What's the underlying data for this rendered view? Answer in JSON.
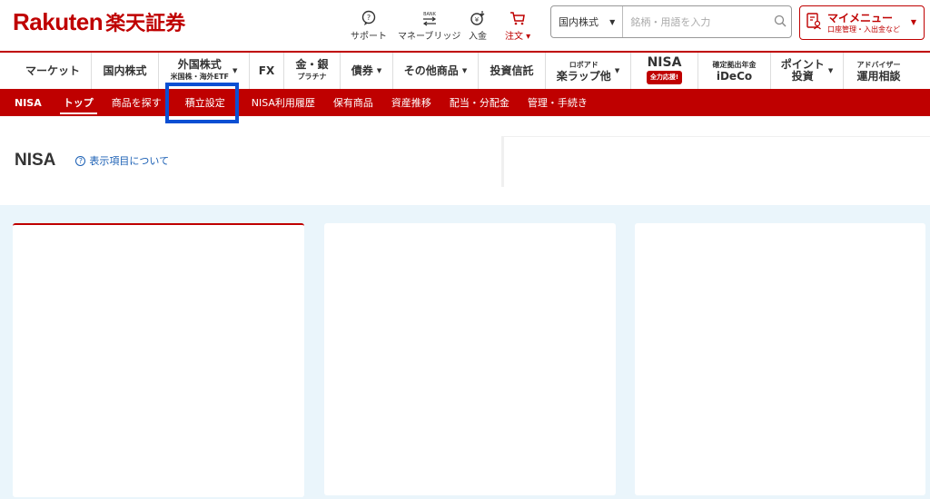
{
  "header": {
    "logo_en": "Rakuten",
    "logo_jp": "楽天証券",
    "utils": [
      {
        "label": "サポート",
        "icon": "support-icon"
      },
      {
        "label": "マネーブリッジ",
        "icon": "bank-icon"
      },
      {
        "label": "入金",
        "icon": "deposit-icon"
      },
      {
        "label": "注文 ▾",
        "icon": "cart-icon"
      }
    ],
    "search": {
      "category": "国内株式",
      "placeholder": "銘柄・用語を入力"
    },
    "my_menu": {
      "title": "マイメニュー",
      "subtitle": "口座管理・入出金など"
    }
  },
  "global_nav": {
    "market": "マーケット",
    "domestic_stocks": "国内株式",
    "foreign_stocks": "外国株式",
    "foreign_stocks_sub": "米国株・海外ETF",
    "fx": "FX",
    "gold_silver": "金・銀",
    "gold_silver_sub": "プラチナ",
    "bonds": "債券",
    "other_products": "その他商品",
    "funds": "投資信託",
    "robo_top": "ロボアド",
    "robo_main": "楽ラップ他",
    "nisa": "NISA",
    "nisa_badge": "全力応援!",
    "ideco_top": "確定拠出年金",
    "ideco_main": "iDeCo",
    "point_top": "ポイント",
    "point_main": "投資",
    "advisor_top": "アドバイザー",
    "advisor_main": "運用相談"
  },
  "sub_nav": {
    "section": "NISA",
    "items": [
      "トップ",
      "商品を探す",
      "積立設定",
      "NISA利用履歴",
      "保有商品",
      "資産推移",
      "配当・分配金",
      "管理・手続き"
    ]
  },
  "page": {
    "title": "NISA",
    "help_link": "表示項目について"
  },
  "colors": {
    "brand": "#bf0000",
    "highlight": "#0a4fd3",
    "main_bg": "#eaf5fb",
    "link": "#1a5fb4"
  }
}
